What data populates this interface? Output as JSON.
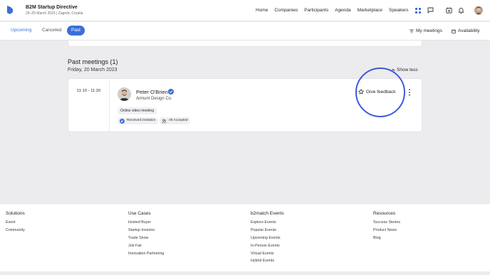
{
  "header": {
    "event_title": "B2M Startup Directive",
    "event_subtitle": "20–25 March 2023 | Zagreb, Croatia",
    "nav": [
      "Home",
      "Companies",
      "Participants",
      "Agenda",
      "Marketplace",
      "Speakers"
    ]
  },
  "tabs": {
    "upcoming": "Upcoming",
    "canceled": "Canceled",
    "past": "Past",
    "my_meetings": "My meetings",
    "availability": "Availability"
  },
  "section": {
    "title": "Past meetings (1)",
    "date": "Friday, 20 March 2023",
    "show_less": "Show less"
  },
  "meeting": {
    "time": "11:10 - 11:20",
    "name": "Peter O'Brien",
    "company": "Armunt Design Co.",
    "type": "Online video meeting",
    "status_invitation": "Received invitation",
    "status_accepted": "All Accepted",
    "feedback_label": "Give feedback"
  },
  "footer": {
    "columns": [
      {
        "title": "Solutions",
        "links": [
          "Event",
          "Community"
        ]
      },
      {
        "title": "Use Cases",
        "links": [
          "Hosted Buyer",
          "Startup Investor",
          "Trade Show",
          "Job Fair",
          "Innovation Partnering"
        ]
      },
      {
        "title": "b2match Events",
        "links": [
          "Explore Events",
          "Popular Events",
          "Upcoming Events",
          "In-Person Events",
          "Virtual Events",
          "Hybrid Events"
        ]
      },
      {
        "title": "Resources",
        "links": [
          "Success Stories",
          "Product News",
          "Blog"
        ]
      }
    ]
  },
  "colors": {
    "accent": "#3b6fd6",
    "highlight": "#3a5bd9"
  }
}
